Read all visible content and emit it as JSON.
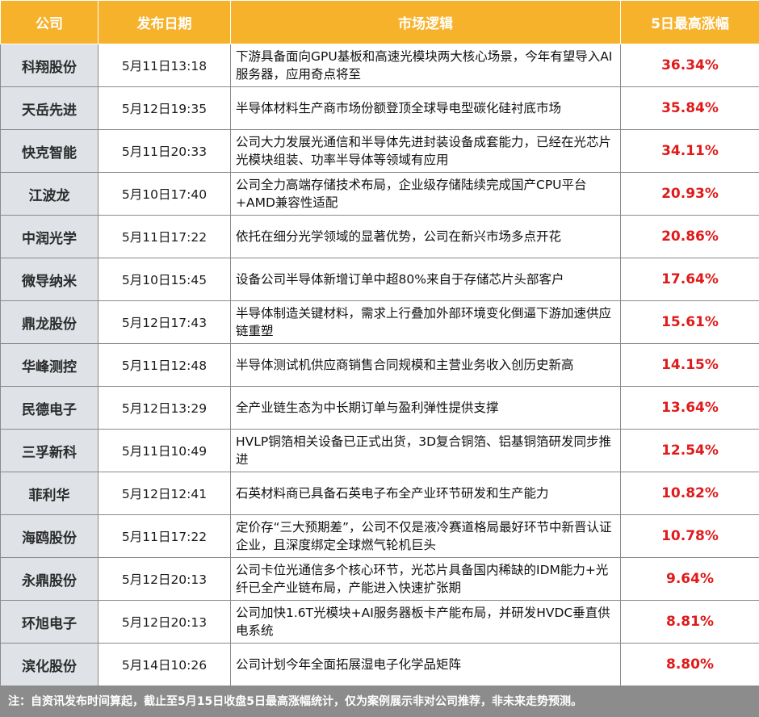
{
  "header": {
    "company": "公司",
    "date": "发布日期",
    "logic": "市场逻辑",
    "gain": "5日最高涨幅"
  },
  "rows": [
    {
      "company": "科翔股份",
      "date": "5月11日13:18",
      "logic": "下游具备面向GPU基板和高速光模块两大核心场景，今年有望导入AI服务器，应用奇点将至",
      "gain": "36.34%"
    },
    {
      "company": "天岳先进",
      "date": "5月12日19:35",
      "logic": "半导体材料生产商市场份额登顶全球导电型碳化硅衬底市场",
      "gain": "35.84%"
    },
    {
      "company": "快克智能",
      "date": "5月11日20:33",
      "logic": "公司大力发展光通信和半导体先进封装设备成套能力，已经在光芯片光模块组装、功率半导体等领域有应用",
      "gain": "34.11%"
    },
    {
      "company": "江波龙",
      "date": "5月10日17:40",
      "logic": "公司全力高端存储技术布局，企业级存储陆续完成国产CPU平台+AMD兼容性适配",
      "gain": "20.93%"
    },
    {
      "company": "中润光学",
      "date": "5月11日17:22",
      "logic": "依托在细分光学领域的显著优势，公司在新兴市场多点开花",
      "gain": "20.86%"
    },
    {
      "company": "微导纳米",
      "date": "5月10日15:45",
      "logic": "设备公司半导体新增订单中超80%来自于存储芯片头部客户",
      "gain": "17.64%"
    },
    {
      "company": "鼎龙股份",
      "date": "5月12日17:43",
      "logic": "半导体制造关键材料，需求上行叠加外部环境变化倒逼下游加速供应链重塑",
      "gain": "15.61%"
    },
    {
      "company": "华峰测控",
      "date": "5月11日12:48",
      "logic": "半导体测试机供应商销售合同规模和主营业务收入创历史新高",
      "gain": "14.15%"
    },
    {
      "company": "民德电子",
      "date": "5月12日13:29",
      "logic": "全产业链生态为中长期订单与盈利弹性提供支撑",
      "gain": "13.64%"
    },
    {
      "company": "三孚新科",
      "date": "5月11日10:49",
      "logic": "HVLP铜箔相关设备已正式出货，3D复合铜箔、铝基铜箔研发同步推进",
      "gain": "12.54%"
    },
    {
      "company": "菲利华",
      "date": "5月12日12:41",
      "logic": "石英材料商已具备石英电子布全产业环节研发和生产能力",
      "gain": "10.82%"
    },
    {
      "company": "海鸥股份",
      "date": "5月11日17:22",
      "logic": "定价存“三大预期差”，公司不仅是液冷赛道格局最好环节中新晋认证企业，且深度绑定全球燃气轮机巨头",
      "gain": "10.78%"
    },
    {
      "company": "永鼎股份",
      "date": "5月12日20:13",
      "logic": "公司卡位光通信多个核心环节，光芯片具备国内稀缺的IDM能力+光纤已全产业链布局，产能进入快速扩张期",
      "gain": "9.64%"
    },
    {
      "company": "环旭电子",
      "date": "5月12日20:13",
      "logic": "公司加快1.6T光模块+AI服务器板卡产能布局，并研发HVDC垂直供电系统",
      "gain": "8.81%"
    },
    {
      "company": "滨化股份",
      "date": "5月14日10:26",
      "logic": "公司计划今年全面拓展湿电子化学品矩阵",
      "gain": "8.80%"
    }
  ],
  "note": "注：自资讯发布时间算起，截止至5月15日收盘5日最高涨幅统计，仅为案例展示非对公司推荐，非未来走势预测。",
  "colors": {
    "header_bg": "#f7b22c",
    "company_bg": "#dfe3e8",
    "gain_text": "#e01a1a",
    "note_bg": "#8c8c8c"
  }
}
